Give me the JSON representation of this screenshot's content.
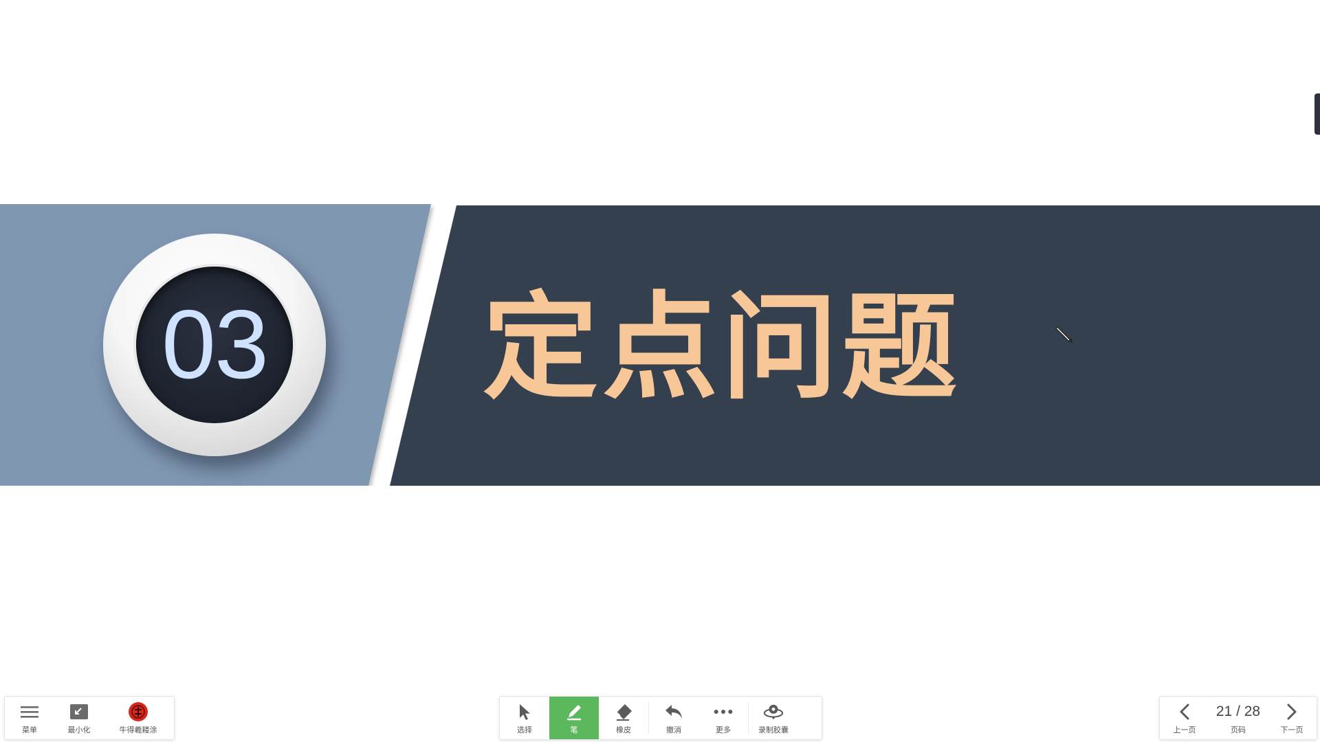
{
  "slide": {
    "number": "03",
    "title": "定点问题",
    "colors": {
      "left_panel": "#8097b2",
      "right_panel": "#363f4f",
      "title_text": "#f7c797",
      "badge_number": "#cfe2ff"
    }
  },
  "toolbar": {
    "left": [
      {
        "id": "menu",
        "label": "菜单",
        "icon": "hamburger-icon"
      },
      {
        "id": "minimize",
        "label": "最小化",
        "icon": "minimize-icon"
      },
      {
        "id": "app",
        "label": "牛得羲耧涂",
        "icon": "red-app-icon"
      }
    ],
    "center": [
      {
        "id": "select",
        "label": "选择",
        "icon": "cursor-arrow-icon"
      },
      {
        "id": "pen",
        "label": "笔",
        "icon": "pen-icon",
        "active": true
      },
      {
        "id": "eraser",
        "label": "橡皮",
        "icon": "eraser-icon"
      },
      {
        "id": "undo",
        "label": "撤消",
        "icon": "undo-icon"
      },
      {
        "id": "more",
        "label": "更多",
        "icon": "more-dots-icon"
      },
      {
        "id": "record",
        "label": "录制胶囊",
        "icon": "record-capsule-icon"
      }
    ],
    "right": {
      "prev_label": "上一页",
      "page_number": "21 / 28",
      "page_label": "页码",
      "next_label": "下一页",
      "current_page": 21,
      "total_pages": 28
    },
    "accent_color": "#5cb85c"
  }
}
